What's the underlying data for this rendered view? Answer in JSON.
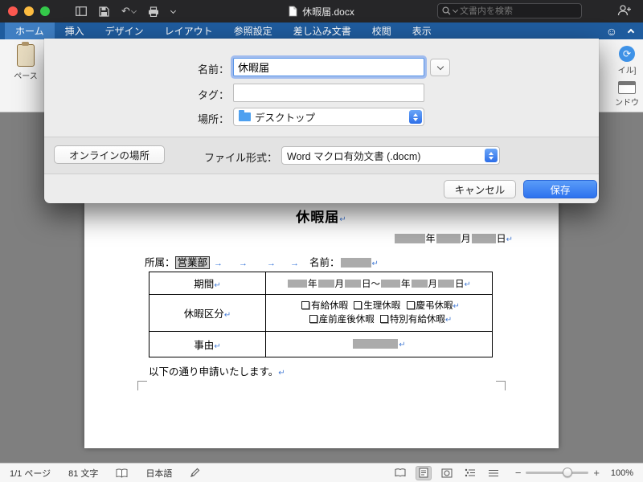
{
  "titlebar": {
    "title": "休暇届.docx",
    "search_placeholder": "文書内を検索"
  },
  "tabs": [
    {
      "label": "ホーム"
    },
    {
      "label": "挿入"
    },
    {
      "label": "デザイン"
    },
    {
      "label": "レイアウト"
    },
    {
      "label": "参照設定"
    },
    {
      "label": "差し込み文書"
    },
    {
      "label": "校閲"
    },
    {
      "label": "表示"
    }
  ],
  "ribbon": {
    "paste_label": "ペース",
    "right_top_label": "イル]",
    "right_bottom_label": "ンドウ"
  },
  "dialog": {
    "name_label": "名前：",
    "name_value": "休暇届",
    "tag_label": "タグ：",
    "location_label": "場所：",
    "location_value": "デスクトップ",
    "online_button_label": "オンラインの場所",
    "format_label": "ファイル形式：",
    "format_value": "Word マクロ有効文書 (.docm)",
    "cancel_label": "キャンセル",
    "save_label": "保存"
  },
  "doc": {
    "title": "休暇届",
    "unit_year": "年",
    "unit_month": "月",
    "unit_day": "日",
    "period_separator": "～",
    "dept_label": "所属：",
    "dept_value": "営業部",
    "name_label": "名前：",
    "row_period": "期間",
    "row_type": "休暇区分",
    "row_reason": "事由",
    "leave_line1": [
      {
        "label": "有給休暇"
      },
      {
        "label": "生理休暇"
      },
      {
        "label": "慶弔休暇"
      }
    ],
    "leave_line2": [
      {
        "label": "産前産後休暇"
      },
      {
        "label": "特別有給休暇"
      }
    ],
    "footer": "以下の通り申請いたします。"
  },
  "statusbar": {
    "page": "1/1 ページ",
    "chars": "81 文字",
    "language": "日本語",
    "zoom": "100%"
  }
}
